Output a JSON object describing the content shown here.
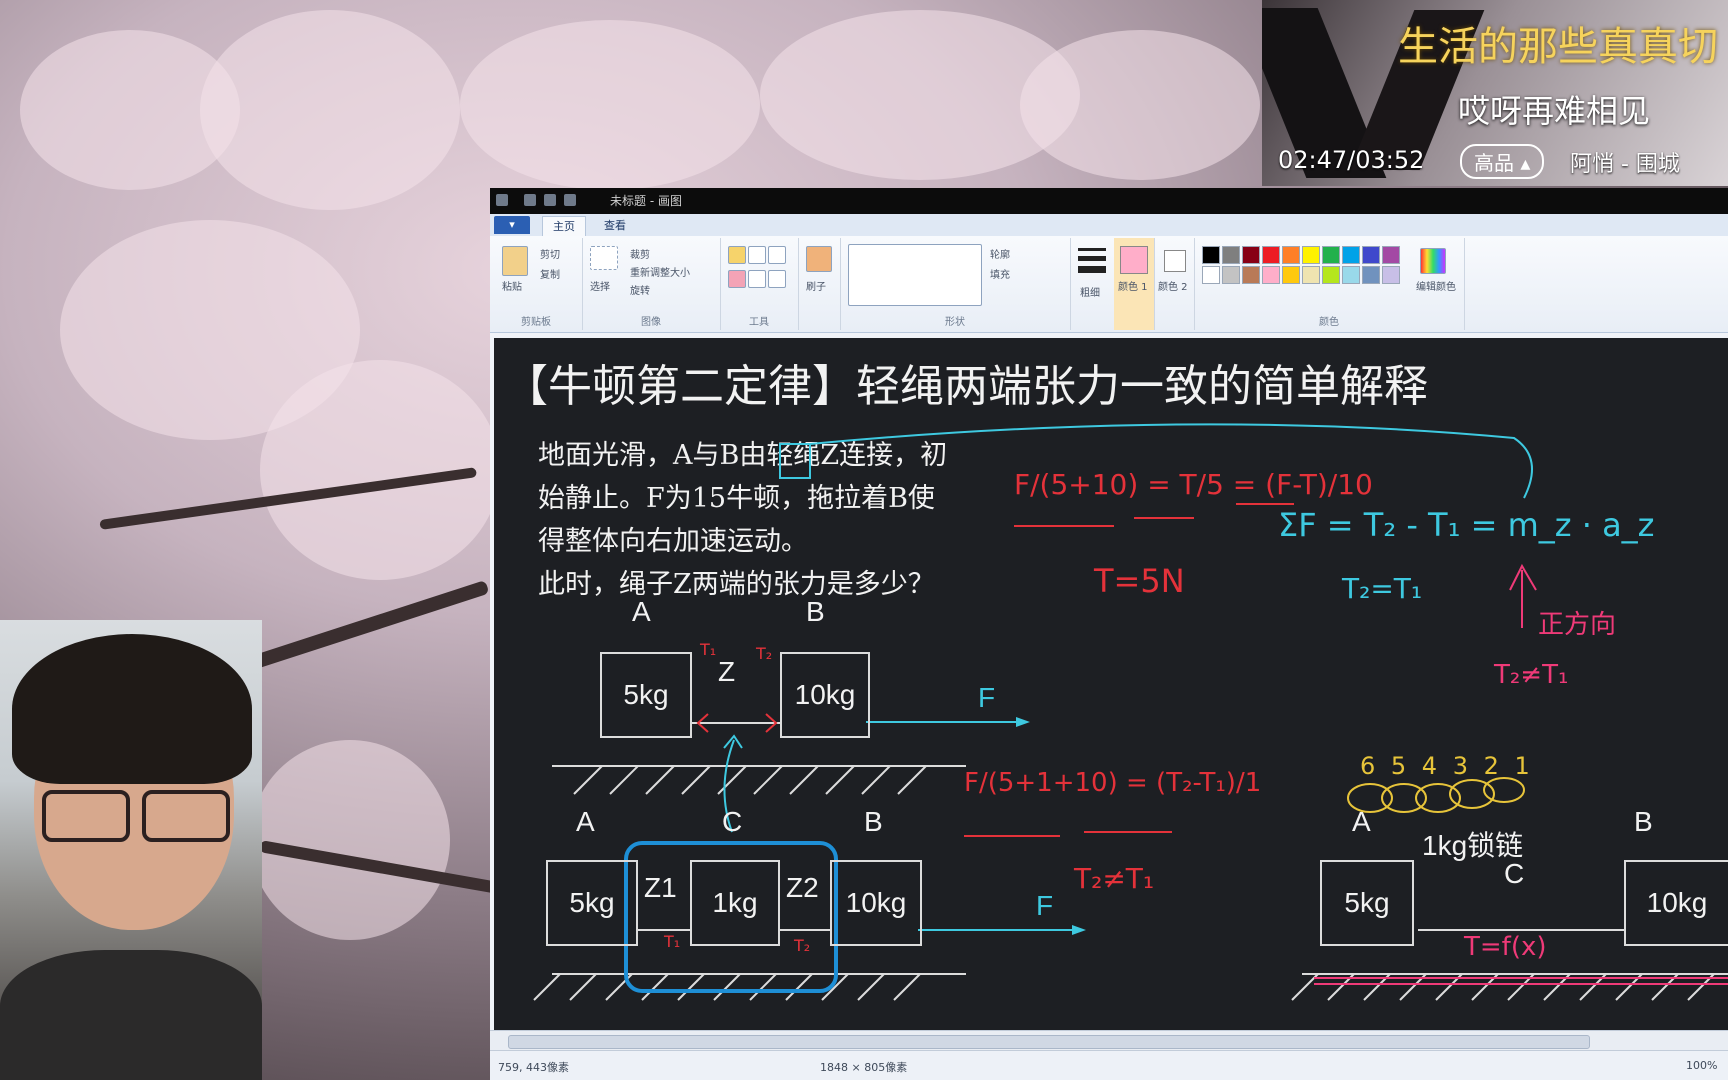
{
  "music": {
    "lyric_line1": "生活的那些真真切",
    "lyric_line2": "哎呀再难相见",
    "time": "02:47/03:52",
    "quality": "高品",
    "song": "阿悄 - 围城"
  },
  "paint": {
    "window_title": "未标题 - 画图",
    "tabs": {
      "file": "▾",
      "home": "主页",
      "view": "查看"
    },
    "ribbon": {
      "clipboard": {
        "paste": "粘贴",
        "cut": "剪切",
        "copy": "复制",
        "label": "剪贴板"
      },
      "image": {
        "select": "选择",
        "crop": "裁剪",
        "resize": "重新调整大小",
        "rotate": "旋转",
        "label": "图像"
      },
      "tools": {
        "label": "工具"
      },
      "brushes": {
        "label": "刷子"
      },
      "shapes": {
        "outline": "轮廓",
        "fill": "填充",
        "label": "形状"
      },
      "size": {
        "label": "粗细"
      },
      "color1": {
        "label": "颜色 1"
      },
      "color2": {
        "label": "颜色 2"
      },
      "colors": {
        "label": "颜色",
        "edit": "编辑颜色"
      }
    },
    "palette": [
      "#000000",
      "#7f7f7f",
      "#880015",
      "#ed1c24",
      "#ff7f27",
      "#fff200",
      "#22b14c",
      "#00a2e8",
      "#3f48cc",
      "#a349a4",
      "#ffffff",
      "#c3c3c3",
      "#b97a57",
      "#ffaec9",
      "#ffc90e",
      "#efe4b0",
      "#b5e61d",
      "#99d9ea",
      "#7092be",
      "#c8bfe7"
    ],
    "status": {
      "cursor": "759, 443像素",
      "dimensions": "1848 × 805像素",
      "zoom": "100%"
    }
  },
  "slide": {
    "title": "【牛顿第二定律】轻绳两端张力一致的简单解释",
    "problem_lines": [
      "地面光滑，A与B由轻绳Z连接，初",
      "始静止。F为15牛顿，拖拉着B使",
      "得整体向右加速运动。",
      "此时，绳子Z两端的张力是多少？"
    ],
    "diagram1": {
      "label_a": "A",
      "label_b": "B",
      "mass_a": "5kg",
      "mass_b": "10kg",
      "rope": "Z",
      "force": "F"
    },
    "diagram2": {
      "label_a": "A",
      "label_b": "B",
      "label_c": "C",
      "mass_a": "5kg",
      "mass_c": "1kg",
      "mass_b": "10kg",
      "rope_left": "Z1",
      "rope_right": "Z2",
      "force": "F"
    },
    "diagram3": {
      "label_a": "A",
      "label_b": "B",
      "label_c": "C",
      "mass_a": "5kg",
      "mass_b": "10kg",
      "chain": "1kg锁链"
    },
    "annotations": {
      "eq1": "F/(5+10) = T/5 = (F-T)/10",
      "t_result": "T=5N",
      "sum_f": "ΣF = T₂ - T₁ = m_z · a_z",
      "t_eq": "T₂=T₁",
      "direction": "正方向",
      "t2_ne_t1": "T₂≠T₁",
      "eq2": "F/(5+1+10) = (T₂-T₁)/1",
      "t2_ne_t1_b": "T₂≠T₁",
      "chain_numbers": "6 5 4 3 2 1",
      "t_fx": "T=f(x)",
      "t1_label": "T₁",
      "t2_label": "T₂"
    }
  }
}
